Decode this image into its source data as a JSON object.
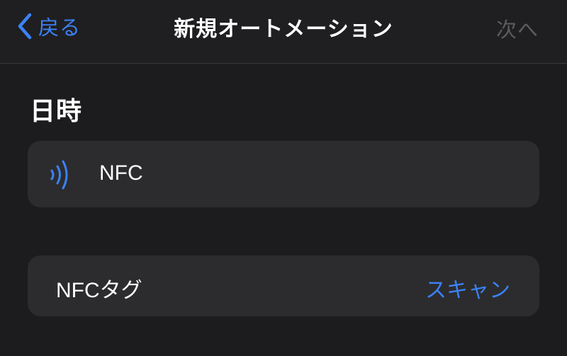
{
  "navbar": {
    "back_label": "戻る",
    "title": "新規オートメーション",
    "next_label": "次へ"
  },
  "section": {
    "header": "日時"
  },
  "trigger": {
    "icon": "nfc-waves-icon",
    "label": "NFC"
  },
  "nfc_tag": {
    "label": "NFCタグ",
    "scan_label": "スキャン"
  },
  "colors": {
    "background": "#1c1c1e",
    "card": "#2c2c2e",
    "accent": "#3b82f6",
    "disabled": "#5b5b60",
    "text": "#ffffff"
  }
}
